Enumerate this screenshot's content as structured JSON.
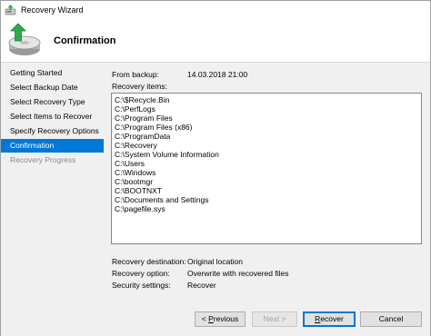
{
  "window": {
    "title": "Recovery Wizard"
  },
  "banner": {
    "heading": "Confirmation",
    "icon": "backup-restore-icon"
  },
  "nav": {
    "items": [
      {
        "label": "Getting Started",
        "state": "normal"
      },
      {
        "label": "Select Backup Date",
        "state": "normal"
      },
      {
        "label": "Select Recovery Type",
        "state": "normal"
      },
      {
        "label": "Select Items to Recover",
        "state": "normal"
      },
      {
        "label": "Specify Recovery Options",
        "state": "normal"
      },
      {
        "label": "Confirmation",
        "state": "active"
      },
      {
        "label": "Recovery Progress",
        "state": "disabled"
      }
    ]
  },
  "summary": {
    "from_backup_label": "From backup:",
    "from_backup_value": "14.03.2018 21:00",
    "recovery_items_label": "Recovery items:",
    "recovery_items": [
      "C:\\$Recycle.Bin",
      "C:\\PerfLogs",
      "C:\\Program Files",
      "C:\\Program Files (x86)",
      "C:\\ProgramData",
      "C:\\Recovery",
      "C:\\System Volume Information",
      "C:\\Users",
      "C:\\Windows",
      "C:\\bootmgr",
      "C:\\BOOTNXT",
      "C:\\Documents and Settings",
      "C:\\pagefile.sys"
    ],
    "recovery_destination_label": "Recovery destination:",
    "recovery_destination_value": "Original location",
    "recovery_option_label": "Recovery option:",
    "recovery_option_value": "Overwrite with recovered files",
    "security_settings_label": "Security settings:",
    "security_settings_value": "Recover"
  },
  "buttons": {
    "previous": {
      "prefix": "< ",
      "mnemonic": "P",
      "rest": "revious"
    },
    "next": {
      "label": "Next >"
    },
    "recover": {
      "mnemonic": "R",
      "rest": "ecover"
    },
    "cancel": {
      "label": "Cancel"
    }
  },
  "colors": {
    "accent": "#0078d7",
    "disabled_text": "#8a8a8a"
  }
}
